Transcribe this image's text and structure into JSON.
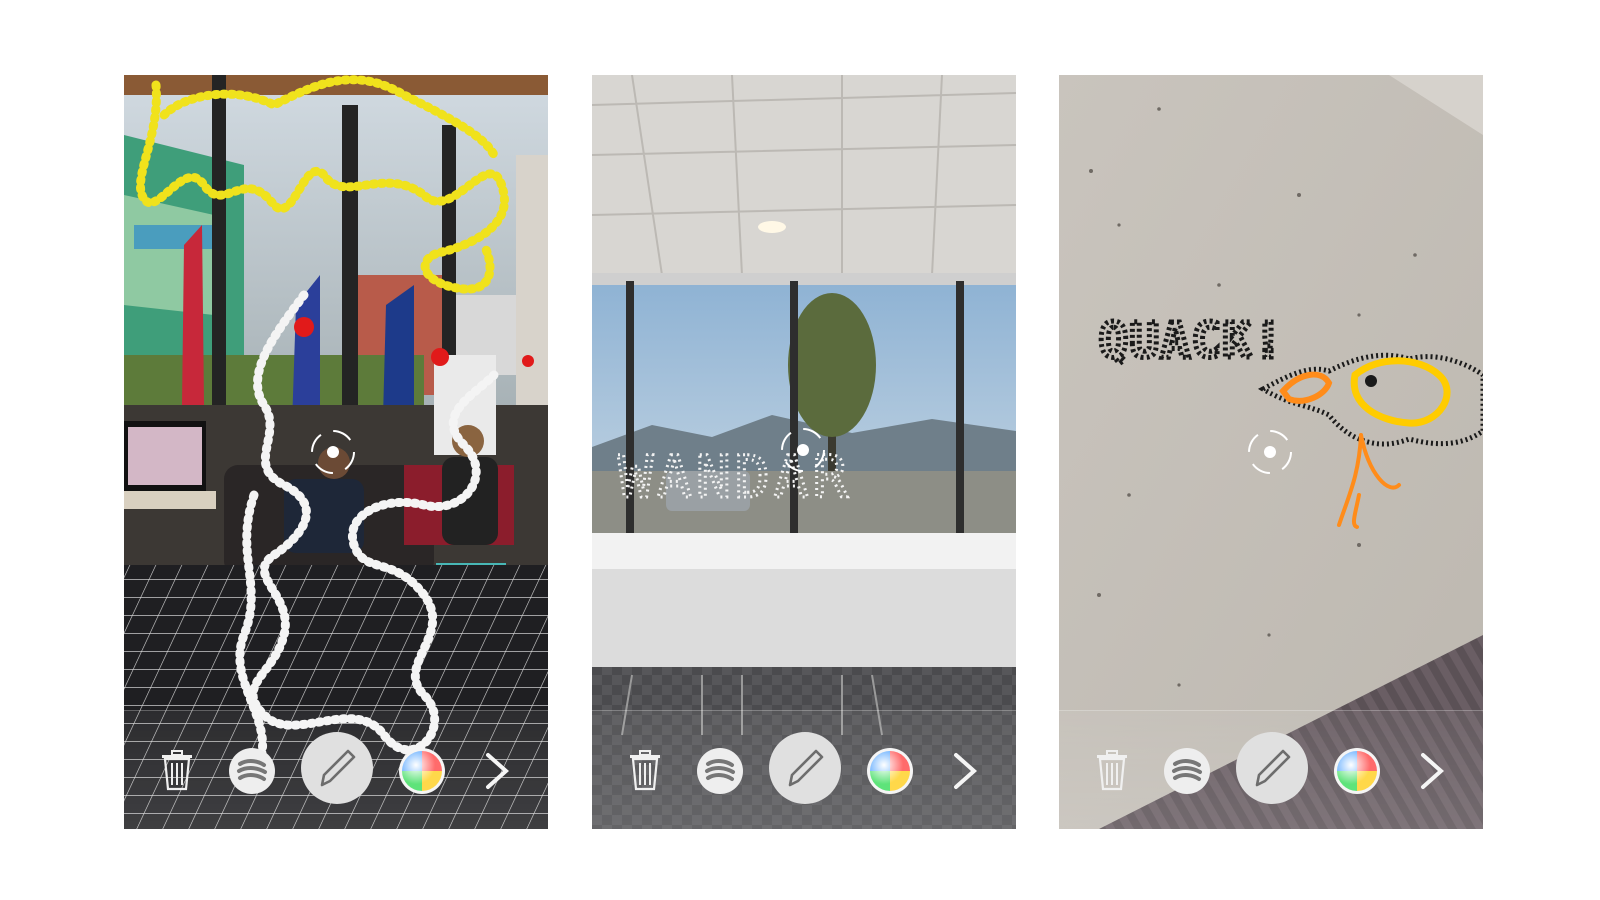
{
  "screens": [
    {
      "name": "lobby-scene",
      "ink_colors": [
        "#f0e21c",
        "#f4f4f4",
        "#e11a1a"
      ]
    },
    {
      "name": "window-scene",
      "drawn_text": "WANDAR",
      "ink_colors": [
        "#f4f4f4"
      ]
    },
    {
      "name": "wall-scene",
      "drawn_text": "QUACK!",
      "ink_colors": [
        "#1a1a1a",
        "#ff8c1a",
        "#ffcc00"
      ]
    }
  ],
  "toolbar": {
    "tools": [
      "trash-icon",
      "brush-style-icon",
      "pen-icon",
      "color-wheel-icon",
      "chevron-right-icon"
    ]
  }
}
